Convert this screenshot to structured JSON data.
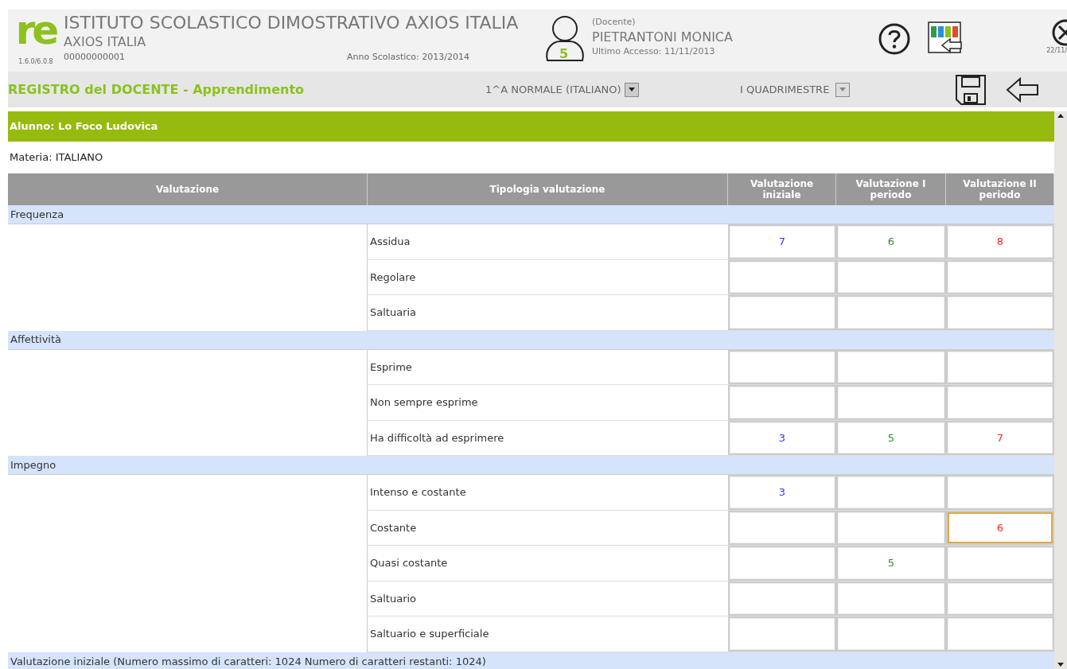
{
  "header": {
    "logo": "re",
    "version": "1.6.0/6.0.8",
    "school": "ISTITUTO SCOLASTICO DIMOSTRATIVO AXIOS ITALIA",
    "org": "AXIOS ITALIA",
    "code": "00000000001",
    "year": "Anno Scolastico: 2013/2014",
    "role": "(Docente)",
    "user": "PIETRANTONI MONICA",
    "badge": "5",
    "last_access": "Ultimo Accesso: 11/11/2013",
    "close_date": "22/11/"
  },
  "toolbar": {
    "title": "REGISTRO del DOCENTE - Apprendimento",
    "class_select": "1^A NORMALE (ITALIANO)",
    "period_select": "I QUADRIMESTRE"
  },
  "student": "Alunno: Lo Foco Ludovica",
  "subject": "Materia: ITALIANO",
  "columns": [
    {
      "label": "Valutazione"
    },
    {
      "label": "Tipologia valutazione"
    },
    {
      "label": "Valutazione iniziale",
      "color": "#3333ff"
    },
    {
      "label": "Valutazione I periodo",
      "color": "#2e8b2e"
    },
    {
      "label": "Valutazione II periodo",
      "color": "#ff2222"
    }
  ],
  "sections": [
    {
      "title": "Frequenza",
      "rows": [
        {
          "label": "Assidua",
          "grades": [
            {
              "value": "7",
              "focused": false
            },
            {
              "value": "6",
              "focused": false
            },
            {
              "value": "8",
              "focused": false
            }
          ]
        },
        {
          "label": "Regolare",
          "grades": [
            {
              "focused": false
            },
            {
              "focused": false
            },
            {
              "focused": false
            }
          ]
        },
        {
          "label": "Saltuaria",
          "grades": [
            {
              "focused": false
            },
            {
              "focused": false
            },
            {
              "focused": false
            }
          ]
        }
      ]
    },
    {
      "title": "Affettività",
      "rows": [
        {
          "label": "Esprime",
          "grades": [
            {
              "focused": false
            },
            {
              "focused": false
            },
            {
              "focused": false
            }
          ]
        },
        {
          "label": "Non sempre esprime",
          "grades": [
            {
              "focused": false
            },
            {
              "focused": false
            },
            {
              "focused": false
            }
          ]
        },
        {
          "label": "Ha difficoltà ad esprimere",
          "grades": [
            {
              "value": "3",
              "focused": false
            },
            {
              "value": "5",
              "focused": false
            },
            {
              "value": "7",
              "focused": false
            }
          ]
        }
      ]
    },
    {
      "title": "Impegno",
      "rows": [
        {
          "label": "Intenso e costante",
          "grades": [
            {
              "value": "3",
              "focused": false
            },
            {
              "focused": false
            },
            {
              "focused": false
            }
          ]
        },
        {
          "label": "Costante",
          "grades": [
            {
              "focused": false
            },
            {
              "focused": false
            },
            {
              "value": "6",
              "focused": true
            }
          ]
        },
        {
          "label": "Quasi costante",
          "grades": [
            {
              "focused": false
            },
            {
              "value": "5",
              "focused": false
            },
            {
              "focused": false
            }
          ]
        },
        {
          "label": "Saltuario",
          "grades": [
            {
              "focused": false
            },
            {
              "focused": false
            },
            {
              "focused": false
            }
          ]
        },
        {
          "label": "Saltuario e superficiale",
          "grades": [
            {
              "focused": false
            },
            {
              "focused": false
            },
            {
              "focused": false
            }
          ]
        }
      ]
    }
  ],
  "footer_section": "Valutazione iniziale (Numero massimo di caratteri: 1024 Numero di caratteri restanti: 1024)"
}
